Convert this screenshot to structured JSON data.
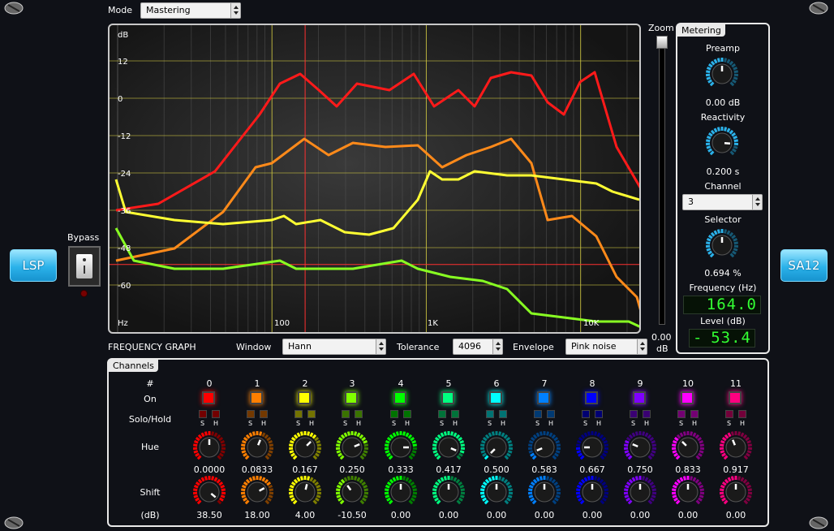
{
  "top": {
    "mode_label": "Mode",
    "mode_value": "Mastering"
  },
  "side": {
    "left_button": "LSP",
    "right_button": "SA12",
    "bypass_label": "Bypass"
  },
  "graph": {
    "y_labels": [
      "dB",
      "12",
      "0",
      "-12",
      "-24",
      "-36",
      "-48",
      "-60"
    ],
    "x_labels": [
      "Hz",
      "100",
      "1K",
      "10K"
    ],
    "caption": "FREQUENCY GRAPH",
    "zoom_label": "Zoom",
    "zoom_value": "0.00",
    "zoom_unit": "dB"
  },
  "graph_controls": {
    "window_label": "Window",
    "window_value": "Hann",
    "tolerance_label": "Tolerance",
    "tolerance_value": "4096",
    "envelope_label": "Envelope",
    "envelope_value": "Pink noise"
  },
  "metering": {
    "tab": "Metering",
    "preamp_label": "Preamp",
    "preamp_value": "0.00 dB",
    "reactivity_label": "Reactivity",
    "reactivity_value": "0.200 s",
    "channel_label": "Channel",
    "channel_value": "3",
    "selector_label": "Selector",
    "selector_value": "0.694 %",
    "frequency_label": "Frequency (Hz)",
    "frequency_value": "164.0",
    "level_label": "Level (dB)",
    "level_sign": "-",
    "level_value": "53.4"
  },
  "channels": {
    "tab": "Channels",
    "row_labels": {
      "num": "#",
      "on": "On",
      "solo_hold": "Solo/Hold",
      "hue": "Hue",
      "shift": "Shift",
      "shift_unit": "(dB)"
    },
    "solo_letter": "S",
    "hold_letter": "H",
    "items": [
      {
        "num": "0",
        "hue": "0.0000",
        "shift": "38.50",
        "color": "#ff0000"
      },
      {
        "num": "1",
        "hue": "0.0833",
        "shift": "18.00",
        "color": "#ff7f00"
      },
      {
        "num": "2",
        "hue": "0.167",
        "shift": "4.00",
        "color": "#ffff00"
      },
      {
        "num": "3",
        "hue": "0.250",
        "shift": "-10.50",
        "color": "#80ff00"
      },
      {
        "num": "4",
        "hue": "0.333",
        "shift": "0.00",
        "color": "#00ff00"
      },
      {
        "num": "5",
        "hue": "0.417",
        "shift": "0.00",
        "color": "#00ff80"
      },
      {
        "num": "6",
        "hue": "0.500",
        "shift": "0.00",
        "color": "#00ffff"
      },
      {
        "num": "7",
        "hue": "0.583",
        "shift": "0.00",
        "color": "#0080ff"
      },
      {
        "num": "8",
        "hue": "0.667",
        "shift": "0.00",
        "color": "#0000ff"
      },
      {
        "num": "9",
        "hue": "0.750",
        "shift": "0.00",
        "color": "#8000ff"
      },
      {
        "num": "10",
        "hue": "0.833",
        "shift": "0.00",
        "color": "#ff00ff"
      },
      {
        "num": "11",
        "hue": "0.917",
        "shift": "0.00",
        "color": "#ff0080"
      }
    ]
  },
  "colors": {
    "accent": "#2bb2ea",
    "panel_border": "#e9e9e9",
    "lcd_green": "#33ff33"
  }
}
